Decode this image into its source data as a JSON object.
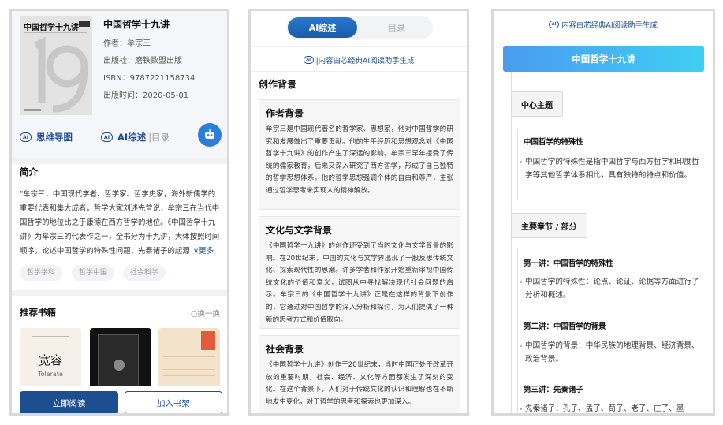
{
  "panel1": {
    "cover_title": "中国哲学十九讲",
    "book_title": "中国哲学十九讲",
    "meta": [
      "作者：牟宗三",
      "出版社：磨铁数盟出版",
      "ISBN：9787221158734",
      "出版时间：2020-05-01"
    ],
    "actions": {
      "mindmap": "思维导图",
      "ai_summary": "AI综述",
      "toc": "|目录"
    },
    "intro_heading": "简介",
    "intro_text": "\"牟宗三，中国现代学者、哲学家、哲学史家，海外新儒学的重要代表和集大成者。哲学大家刘述先曾说，牟宗三在当代中国哲学的地位比之于康德在西方哲学的地位。《中国哲学十九讲》为牟宗三的代表作之一，全书分为十九讲，大体按照时间顺序，论述中国哲学的特殊性问题、先秦诸子的起源",
    "more": "更多",
    "tags": [
      "哲学学科",
      "哲学中国",
      "社会科学"
    ],
    "recommend_heading": "推荐书籍",
    "refresh": "换一换",
    "rec_books": {
      "b1_title": "宽容",
      "b1_en": "Tolerate"
    },
    "buttons": {
      "read": "立即阅读",
      "shelf": "加入书架"
    }
  },
  "panel2": {
    "tabs": [
      "AI综述",
      "目录"
    ],
    "gen_note": "|内容由芯经典AI阅读助手生成",
    "heading": "创作背景",
    "cards": [
      {
        "title": "作者背景",
        "body": "牟宗三是中国现代著名的哲学家、思想家，他对中国哲学的研究和发展做出了重要贡献。他的生平经历和思想观念对《中国哲学十九讲》的创作产生了深远的影响。牟宗三早年接受了传统的儒家教育，后来又深入研究了西方哲学，形成了自己独特的哲学思想体系。他的哲学思想强调个体的自由和尊严，主张通过哲学思考来实现人的精神解放。"
      },
      {
        "title": "文化与文学背景",
        "body": "《中国哲学十九讲》的创作还受到了当时文化与文学背景的影响。在20世纪末，中国的文化与文学界出现了一股反思传统文化、探索现代性的思潮。许多学者和作家开始重新审视中国传统文化的价值和意义，试图从中寻找解决现代社会问题的启示。牟宗三的《中国哲学十九讲》正是在这样的背景下创作的，它通过对中国哲学的深入分析和探讨，为人们提供了一种新的思考方式和价值取向。"
      },
      {
        "title": "社会背景",
        "body": "《中国哲学十九讲》创作于20世纪末，当时中国正处于改革开放的重要时期，社会、经济、文化等方面都发生了深刻的变化。在这个背景下，人们对于传统文化的认识和理解也在不断地发生变化，对于哲学的思考和探索也更加深入。"
      }
    ]
  },
  "panel3": {
    "gen_note": "内容由芯经典AI阅读助手生成",
    "title": "中国哲学十九讲",
    "node_center": "中心主题",
    "center_sub": "中国哲学的特殊性",
    "center_bullet": "中国哲学的特殊性是指中国哲学与西方哲学和印度哲学等其他哲学体系相比，具有独特的特点和价值。",
    "node_chapters": "主要章节 / 部分",
    "chapters": [
      {
        "title": "第一讲：中国哲学的特殊性",
        "bullet": "中国哲学的特殊性：论点、论证、论据等方面进行了分析和概述。"
      },
      {
        "title": "第二讲：中国哲学的背景",
        "bullet": "中国哲学的背景：中华民族的地理背景、经济背景、政治背景。"
      },
      {
        "title": "第三讲：先秦诸子",
        "bullet": "先秦诸子：孔子、孟子、荀子、老子、庄子、墨"
      }
    ]
  },
  "colors": {
    "accent": "#1d4e8f",
    "gradient_start": "#4a9bf0",
    "gradient_end": "#3fcff3"
  }
}
